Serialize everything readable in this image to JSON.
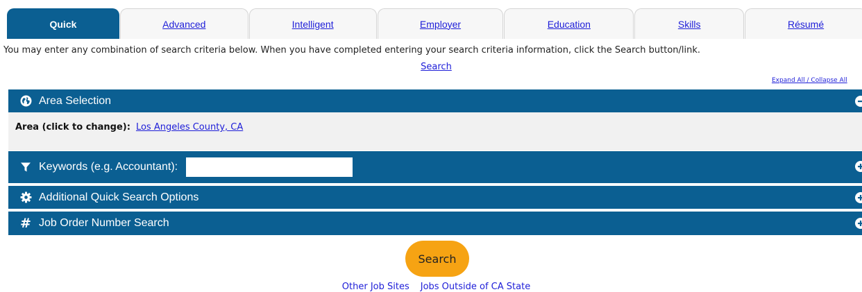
{
  "tabs": [
    {
      "label": "Quick",
      "active": true
    },
    {
      "label": "Advanced",
      "active": false
    },
    {
      "label": "Intelligent",
      "active": false
    },
    {
      "label": "Employer",
      "active": false
    },
    {
      "label": "Education",
      "active": false
    },
    {
      "label": "Skills",
      "active": false
    },
    {
      "label": "Résumé",
      "active": false
    }
  ],
  "intro_text": "You may enter any combination of search criteria below. When you have completed entering your search criteria information, click the Search button/link.",
  "top_search_link": "Search",
  "expand_collapse": "Expand All / Collapse All",
  "sections": {
    "area": {
      "title": "Area Selection",
      "icon": "globe-icon",
      "toggle": "collapse"
    },
    "keywords": {
      "title": "Keywords (e.g. Accountant):",
      "icon": "filter-icon",
      "toggle": "expand",
      "input_value": ""
    },
    "additional": {
      "title": "Additional Quick Search Options",
      "icon": "gear-icon",
      "toggle": "expand"
    },
    "job_order": {
      "title": "Job Order Number Search",
      "icon": "hash-icon",
      "toggle": "expand"
    }
  },
  "area_panel": {
    "label": "Area (click to change):",
    "value": "Los Angeles County, CA"
  },
  "search_button": "Search",
  "footer_links": [
    "Other Job Sites",
    "Jobs Outside of CA State"
  ],
  "colors": {
    "primary": "#0b5f92",
    "accent": "#f6a313",
    "link": "#1d1dd8",
    "panel_bg": "#f1f1f1"
  }
}
